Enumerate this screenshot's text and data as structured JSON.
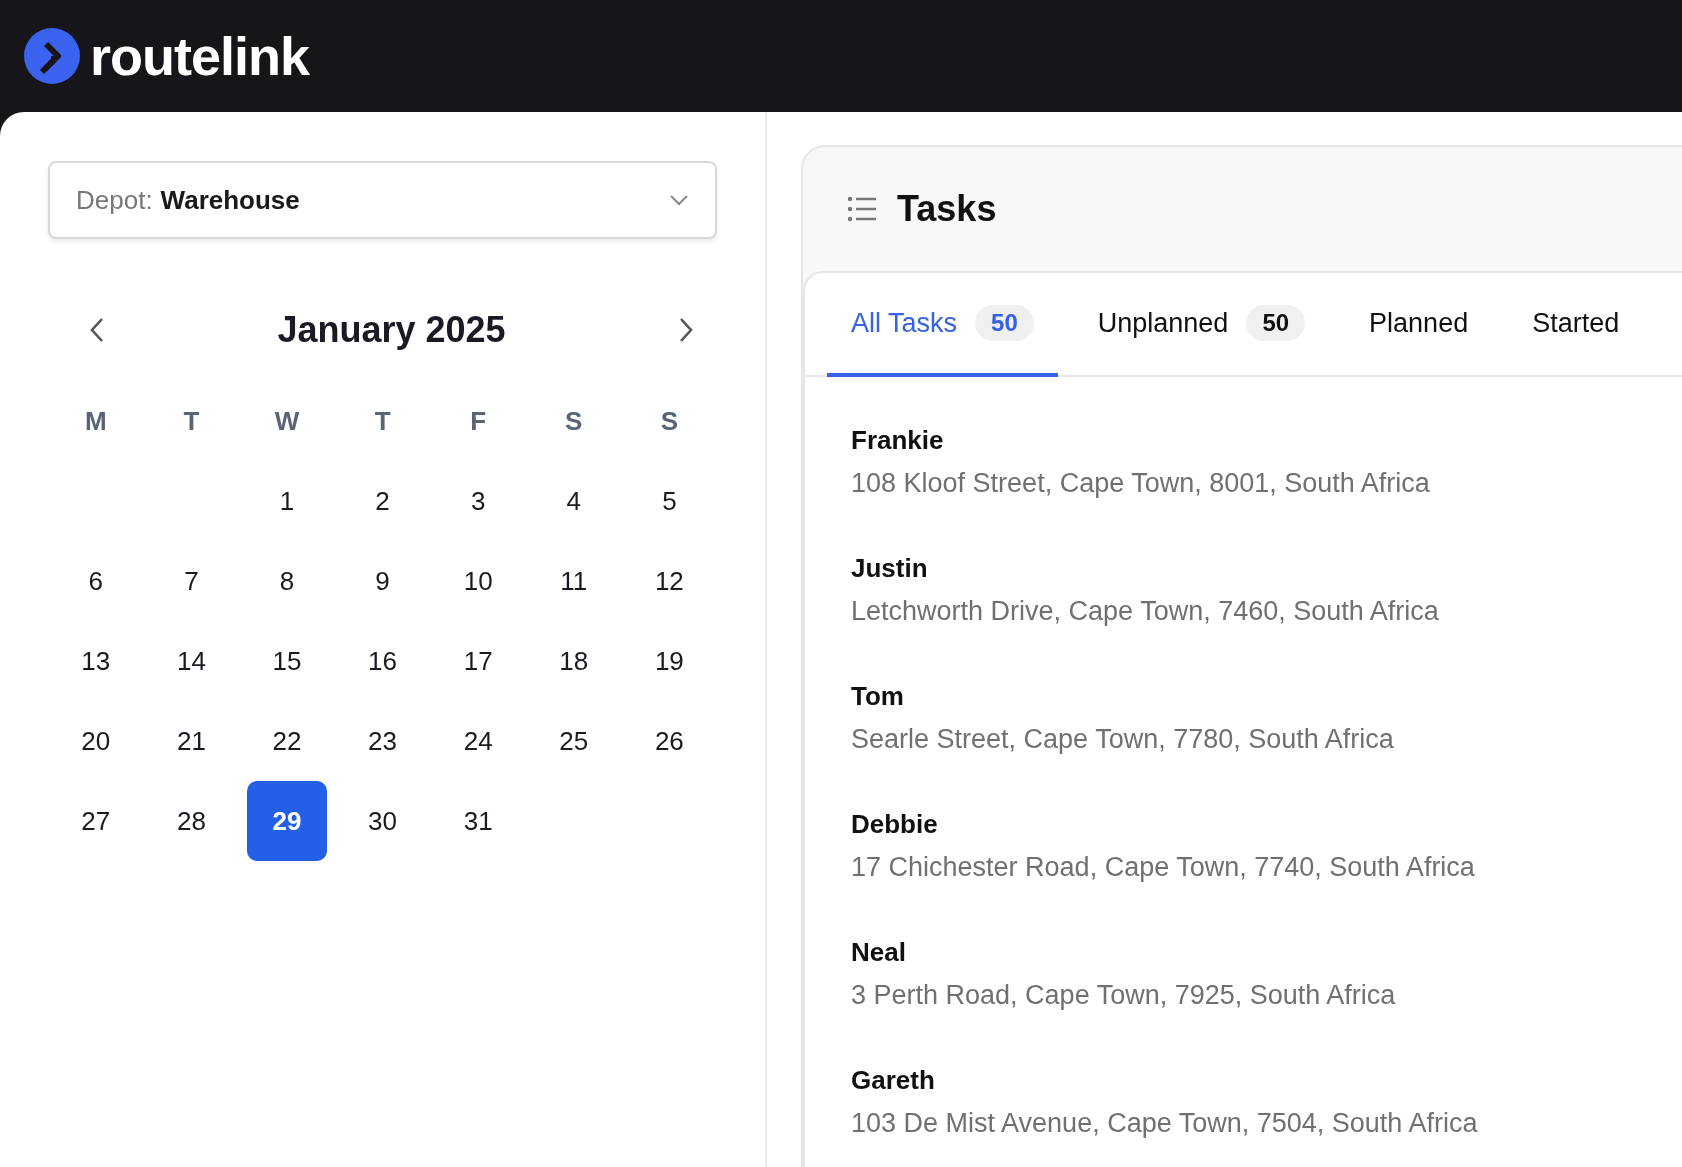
{
  "app": {
    "logo": "routelink"
  },
  "depot": {
    "label": "Depot:",
    "value": "Warehouse"
  },
  "calendar": {
    "month": "January 2025",
    "weekdays": [
      "M",
      "T",
      "W",
      "T",
      "F",
      "S",
      "S"
    ],
    "weeks": [
      {
        "days": [
          {
            "kind": "blank"
          },
          {
            "kind": "blank"
          },
          {
            "kind": "day",
            "label": "1",
            "selected": false
          },
          {
            "label": "2",
            "selected": false
          },
          {
            "label": "3",
            "selected": false
          },
          {
            "label": "4",
            "selected": false
          },
          {
            "label": "5",
            "selected": false
          }
        ]
      },
      {
        "days": [
          {
            "label": "6",
            "selected": false
          },
          {
            "label": "7",
            "selected": false
          },
          {
            "label": "8",
            "selected": false
          },
          {
            "label": "9",
            "selected": false
          },
          {
            "label": "10",
            "selected": false
          },
          {
            "label": "11",
            "selected": false
          },
          {
            "label": "12",
            "selected": false
          }
        ]
      },
      {
        "days": [
          {
            "label": "13",
            "selected": false
          },
          {
            "label": "14",
            "selected": false
          },
          {
            "label": "15",
            "selected": false
          },
          {
            "label": "16",
            "selected": false
          },
          {
            "label": "17",
            "selected": false
          },
          {
            "label": "18",
            "selected": false
          },
          {
            "label": "19",
            "selected": false
          }
        ]
      },
      {
        "days": [
          {
            "label": "20",
            "selected": false
          },
          {
            "label": "21",
            "selected": false
          },
          {
            "label": "22",
            "selected": false
          },
          {
            "label": "23",
            "selected": false
          },
          {
            "label": "24",
            "selected": false
          },
          {
            "label": "25",
            "selected": false
          },
          {
            "label": "26",
            "selected": false
          }
        ]
      },
      {
        "days": [
          {
            "label": "27",
            "selected": false
          },
          {
            "label": "28",
            "selected": false
          },
          {
            "label": "29",
            "selected": true
          },
          {
            "label": "30",
            "selected": false
          },
          {
            "label": "31",
            "selected": false
          },
          {
            "kind": "blank"
          },
          {
            "kind": "blank"
          }
        ]
      }
    ]
  },
  "tasks_panel": {
    "title": "Tasks",
    "tabs": [
      {
        "label": "All Tasks",
        "count": "50",
        "selected": true
      },
      {
        "label": "Unplanned",
        "count": "50",
        "selected": false
      },
      {
        "label": "Planned",
        "selected": false
      },
      {
        "label": "Started",
        "selected": false
      }
    ],
    "tasks": [
      {
        "name": "Frankie",
        "address": "108 Kloof Street, Cape Town, 8001, South Africa"
      },
      {
        "name": "Justin",
        "address": "Letchworth Drive, Cape Town, 7460, South Africa"
      },
      {
        "name": "Tom",
        "address": "Searle Street, Cape Town, 7780, South Africa"
      },
      {
        "name": "Debbie",
        "address": "17 Chichester Road, Cape Town, 7740, South Africa"
      },
      {
        "name": "Neal",
        "address": "3 Perth Road, Cape Town, 7925, South Africa"
      },
      {
        "name": "Gareth",
        "address": "103 De Mist Avenue, Cape Town, 7504, South Africa"
      }
    ]
  }
}
